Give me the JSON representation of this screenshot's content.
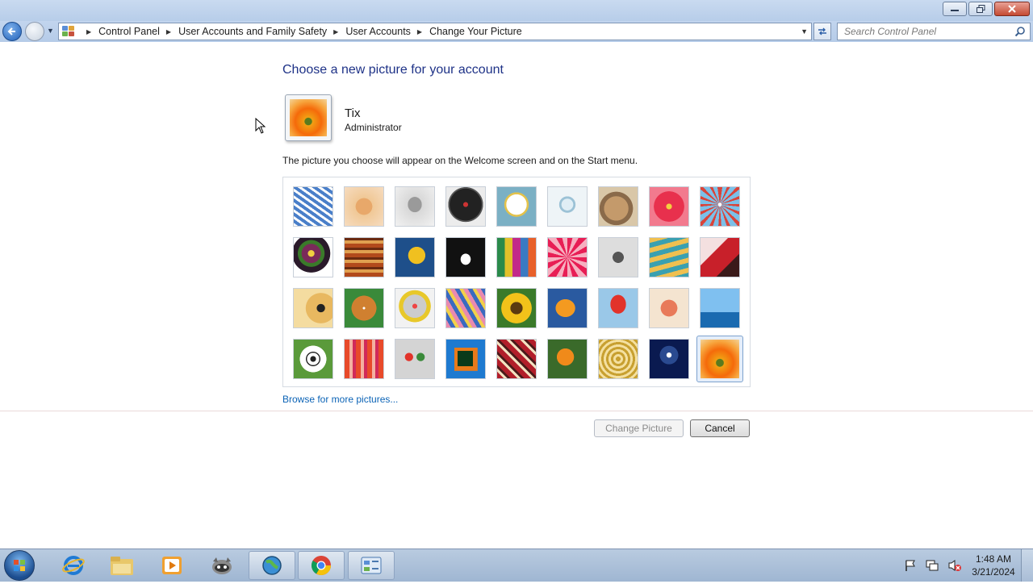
{
  "window": {
    "controls": [
      "minimize",
      "restore",
      "close"
    ]
  },
  "breadcrumb": [
    "Control Panel",
    "User Accounts and Family Safety",
    "User Accounts",
    "Change Your Picture"
  ],
  "search": {
    "placeholder": "Search Control Panel"
  },
  "content": {
    "heading": "Choose a new picture for your account",
    "username": "Tix",
    "role": "Administrator",
    "description": "The picture you choose will appear on the Welcome screen and on the Start menu.",
    "browse_link": "Browse for more pictures...",
    "change_button": "Change Picture",
    "cancel_button": "Cancel"
  },
  "pictures": [
    [
      "roller-coaster",
      "starfish",
      "robot-figure",
      "turntable",
      "lucky-cat",
      "gyroscope",
      "sleeping-kitten",
      "pink-flower",
      "ferris-wheel"
    ],
    [
      "ball",
      "fabric-weave",
      "ginkgo-leaf",
      "dog",
      "crayons",
      "star-lantern",
      "jacks",
      "stairs",
      "paper-crane"
    ],
    [
      "guitar",
      "pomeranian",
      "toy-robot",
      "scarf",
      "sunflower",
      "fish",
      "hot-air-balloon",
      "toy-figure",
      "sailboat"
    ],
    [
      "soccer-ball",
      "striped-fabric",
      "marbles",
      "window",
      "woven-textile",
      "butterfly",
      "spiral",
      "lighthouse",
      "orange-flower"
    ]
  ],
  "selected_picture": "orange-flower",
  "taskbar": {
    "items": [
      "internet-explorer",
      "file-explorer",
      "media-player",
      "raccoon-app",
      "network-app",
      "chrome",
      "control-panel"
    ],
    "active_items": [
      "network-app",
      "chrome",
      "control-panel"
    ],
    "time": "1:48 AM",
    "date": "3/21/2024"
  }
}
